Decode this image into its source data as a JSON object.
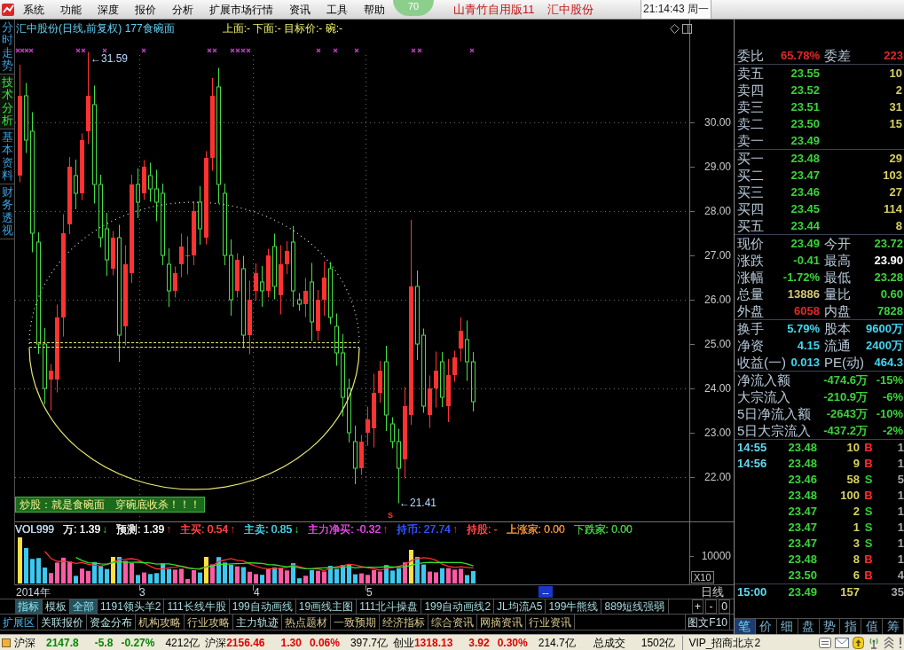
{
  "menu_bar": {
    "items": [
      "系统",
      "功能",
      "深度",
      "报价",
      "分析",
      "扩展市场行情",
      "资讯",
      "工具",
      "帮助"
    ],
    "gauge": "70",
    "edition": "山青竹自用版11",
    "stock": "汇中股份",
    "clock": "21:14:43 周一"
  },
  "side_tabs": [
    {
      "label": "分时走势",
      "selected": false
    },
    {
      "label": "技术分析",
      "selected": true
    },
    {
      "label": "基本资料",
      "selected": false
    },
    {
      "label": "财务透视",
      "selected": false
    }
  ],
  "chart": {
    "title": "汇中股份(日线,前复权) 177食碗面",
    "formula_values": "上面:- 下面:- 目标价:- 碗:-",
    "price_labels": [
      "30.00",
      "29.00",
      "28.00",
      "27.00",
      "26.00",
      "25.00",
      "24.00",
      "23.00",
      "22.00"
    ],
    "high_label": "←31.59",
    "low_label": "←21.41",
    "signal": "s",
    "note": "炒股：就是食碗面　穿碗底收杀！！！"
  },
  "volume_pane": {
    "legend": [
      {
        "text": "VOL999",
        "color": "#b8d0e0"
      },
      {
        "text": "万: 1.39",
        "color": "#e8e8e8",
        "arrow": "↓",
        "rising": false
      },
      {
        "text": "预测: 1.39",
        "color": "#e8e8e8",
        "arrow": "↑",
        "rising": true
      },
      {
        "text": "主买: 0.54",
        "color": "#ff4040",
        "arrow": "↑",
        "rising": true
      },
      {
        "text": "主卖: 0.85",
        "color": "#40c8d8",
        "arrow": "↓",
        "rising": false
      },
      {
        "text": "主力净买: -0.32",
        "color": "#e040e0",
        "arrow": "↑",
        "rising": true
      },
      {
        "text": "持币: 27.74",
        "color": "#3050ff",
        "arrow": "↑",
        "rising": true
      },
      {
        "text": "持股: -",
        "color": "#ff4040"
      },
      {
        "text": "上涨家: 0.00",
        "color": "#e08838"
      },
      {
        "text": "下跌家: 0.00",
        "color": "#40c040"
      }
    ],
    "axis_label": "10000",
    "scale": "X10"
  },
  "date_axis": {
    "labels": [
      "2014年",
      "3",
      "4",
      "5"
    ],
    "range": "--",
    "period": "日线"
  },
  "indicator_tabs": [
    {
      "label": "指标",
      "selected": true
    },
    {
      "label": "模板",
      "selected": false
    },
    {
      "label": "全部",
      "selected": true
    },
    {
      "label": "1191领头羊2",
      "selected": false
    },
    {
      "label": "111长线牛股",
      "selected": false
    },
    {
      "label": "199自动画线",
      "selected": false
    },
    {
      "label": "19画线主图",
      "selected": false
    },
    {
      "label": "111北斗操盘",
      "selected": false
    },
    {
      "label": "199自动画线2",
      "selected": false
    },
    {
      "label": "JL均流A5",
      "selected": false
    },
    {
      "label": "199牛熊线",
      "selected": false
    },
    {
      "label": "889短线强弱",
      "selected": false
    }
  ],
  "zoom_buttons": [
    "+",
    "-",
    "0"
  ],
  "info_tabs": [
    {
      "label": "扩展区",
      "kind": "area"
    },
    {
      "label": "关联报价",
      "kind": "quote"
    },
    {
      "label": "资金分布",
      "kind": "quote"
    },
    {
      "label": "机构攻略",
      "kind": "info"
    },
    {
      "label": "行业攻略",
      "kind": "info"
    },
    {
      "label": "主力轨迹",
      "kind": "quote"
    },
    {
      "label": "热点题材",
      "kind": "info"
    },
    {
      "label": "一致预期",
      "kind": "info"
    },
    {
      "label": "经济指标",
      "kind": "info"
    },
    {
      "label": "综合资讯",
      "kind": "info"
    },
    {
      "label": "网摘资讯",
      "kind": "info"
    },
    {
      "label": "行业资讯",
      "kind": "info"
    }
  ],
  "f10_button": "图文F10",
  "quote_panel": {
    "ratio": [
      {
        "label": "委比",
        "value": "65.78%",
        "color": "#e02828"
      },
      {
        "label": "委差",
        "value": "223",
        "color": "#e02828"
      }
    ],
    "asks": [
      {
        "label": "卖五",
        "price": "23.55",
        "volume": "10"
      },
      {
        "label": "卖四",
        "price": "23.52",
        "volume": "2"
      },
      {
        "label": "卖三",
        "price": "23.51",
        "volume": "31"
      },
      {
        "label": "卖二",
        "price": "23.50",
        "volume": "15"
      },
      {
        "label": "卖一",
        "price": "23.49"
      }
    ],
    "bids": [
      {
        "label": "买一",
        "price": "23.48",
        "volume": "29"
      },
      {
        "label": "买二",
        "price": "23.47",
        "volume": "103"
      },
      {
        "label": "买三",
        "price": "23.46",
        "volume": "27"
      },
      {
        "label": "买四",
        "price": "23.45",
        "volume": "114"
      },
      {
        "label": "买五",
        "price": "23.44",
        "volume": "8"
      }
    ],
    "stats": [
      [
        {
          "label": "现价",
          "value": "23.49",
          "color": "#3cd23c"
        },
        {
          "label": "今开",
          "value": "23.72",
          "color": "#3cd23c"
        }
      ],
      [
        {
          "label": "涨跌",
          "value": "-0.41",
          "color": "#3cd23c"
        },
        {
          "label": "最高",
          "value": "23.90",
          "color": "#ffffff"
        }
      ],
      [
        {
          "label": "涨幅",
          "value": "-1.72%",
          "color": "#3cd23c"
        },
        {
          "label": "最低",
          "value": "23.28",
          "color": "#3cd23c"
        }
      ],
      [
        {
          "label": "总量",
          "value": "13886",
          "color": "#d8c878"
        },
        {
          "label": "量比",
          "value": "0.60",
          "color": "#3cd23c"
        }
      ],
      [
        {
          "label": "外盘",
          "value": "6058",
          "color": "#e02828"
        },
        {
          "label": "内盘",
          "value": "7828",
          "color": "#3cd23c"
        }
      ]
    ],
    "fundamentals": [
      [
        {
          "label": "换手",
          "value": "5.79%",
          "color": "#40d8f0"
        },
        {
          "label": "股本",
          "value": "9600万",
          "color": "#40d8f0"
        }
      ],
      [
        {
          "label": "净资",
          "value": "4.15",
          "color": "#40d8f0"
        },
        {
          "label": "流通",
          "value": "2400万",
          "color": "#40d8f0"
        }
      ],
      [
        {
          "label": "收益(一)",
          "value": "0.013",
          "color": "#40d8f0"
        },
        {
          "label": "PE(动)",
          "value": "464.3",
          "color": "#40d8f0"
        }
      ]
    ],
    "flows": [
      {
        "label": "净流入额",
        "amount": "-474.6万",
        "percent": "-15%"
      },
      {
        "label": "大宗流入",
        "amount": "-210.9万",
        "percent": "-6%"
      },
      {
        "label": "5日净流入额",
        "amount": "-2643万",
        "percent": "-10%"
      },
      {
        "label": "5日大宗流入",
        "amount": "-437.2万",
        "percent": "-2%"
      }
    ],
    "ticks": [
      {
        "time": "14:55",
        "price": "23.48",
        "volume": "10",
        "side": "B",
        "kind": "buy",
        "count": "1"
      },
      {
        "time": "14:56",
        "price": "23.48",
        "volume": "9",
        "side": "B",
        "kind": "buy",
        "count": "1"
      },
      {
        "price": "23.46",
        "volume": "58",
        "side": "S",
        "kind": "sell",
        "count": "5"
      },
      {
        "price": "23.48",
        "volume": "100",
        "side": "B",
        "kind": "buy",
        "count": "1"
      },
      {
        "price": "23.47",
        "volume": "2",
        "side": "S",
        "kind": "sell",
        "count": "1"
      },
      {
        "price": "23.47",
        "volume": "1",
        "side": "S",
        "kind": "sell",
        "count": "1"
      },
      {
        "price": "23.47",
        "volume": "3",
        "side": "S",
        "kind": "sell",
        "count": "1"
      },
      {
        "price": "23.48",
        "volume": "8",
        "side": "B",
        "kind": "buy",
        "count": "1"
      },
      {
        "price": "23.50",
        "volume": "6",
        "side": "B",
        "kind": "buy",
        "count": "4"
      }
    ],
    "closing_tick": {
      "time": "15:00",
      "price": "23.49",
      "volume": "157",
      "count": "35"
    },
    "tabs": [
      {
        "label": "笔",
        "selected": true
      },
      {
        "label": "价",
        "selected": false
      },
      {
        "label": "细",
        "selected": false
      },
      {
        "label": "盘",
        "selected": false
      },
      {
        "label": "势",
        "selected": false
      },
      {
        "label": "指",
        "selected": false
      },
      {
        "label": "值",
        "selected": false
      },
      {
        "label": "筹",
        "selected": false
      }
    ]
  },
  "status_bar": {
    "indices": [
      {
        "name": "沪深",
        "value": "2147.8",
        "change": "-5.8",
        "percent": "-0.27%",
        "amount": "4212亿",
        "rising": false
      },
      {
        "name": "沪深",
        "value": "2156.46",
        "change": "1.30",
        "percent": "0.06%",
        "amount": "397.7亿",
        "rising": true
      },
      {
        "name": "创业",
        "value": "1318.13",
        "change": "3.92",
        "percent": "0.30%",
        "amount": "214.7亿",
        "rising": true
      }
    ],
    "total_label": "总成交",
    "total": "1502亿",
    "server": "VIP_招商北京2"
  }
}
